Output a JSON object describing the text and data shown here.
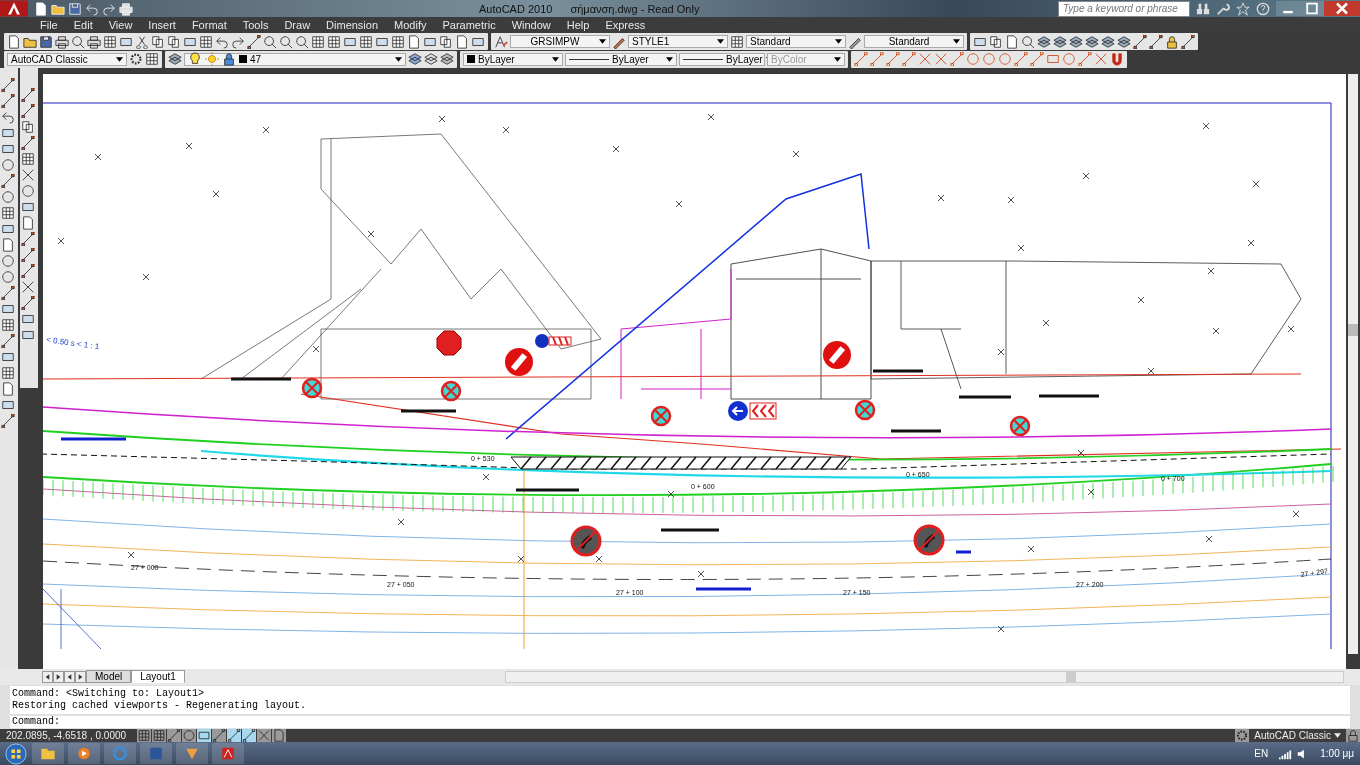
{
  "title_bar": {
    "app_name": "AutoCAD 2010",
    "document": "σήμανση.dwg - Read Only",
    "search": {
      "placeholder": "Type a keyword or phrase"
    }
  },
  "menu": [
    "File",
    "Edit",
    "View",
    "Insert",
    "Format",
    "Tools",
    "Draw",
    "Dimension",
    "Modify",
    "Parametric",
    "Window",
    "Help",
    "Express"
  ],
  "styles_toolbar": {
    "text_style": "GRSIMPW",
    "dimension_style": "STYLE1",
    "table_style": "Standard",
    "multileader_style": "Standard"
  },
  "workspace_toolbar": {
    "workspace": "AutoCAD Classic"
  },
  "layers_toolbar": {
    "layer": "47"
  },
  "properties_toolbar": {
    "color_setting": "ByLayer",
    "linetype": "ByLayer",
    "lineweight": "ByLayer",
    "plot_style": "ByColor",
    "plot_style_disabled": true
  },
  "drawing": {
    "scale_note": "< 0.50  s < 1 : 1",
    "chainages": [
      "27 + 000",
      "27 + 050",
      "27 + 100",
      "27 + 150",
      "27 + 200",
      "27 + 297",
      "0 + 530",
      "0 + 600",
      "0 + 650",
      "0 + 700"
    ],
    "signs": [
      {
        "kind": "stop"
      },
      {
        "kind": "keep-left-chevron"
      },
      {
        "kind": "no-entry"
      },
      {
        "kind": "no-entry"
      },
      {
        "kind": "no-stopping"
      },
      {
        "kind": "no-stopping"
      },
      {
        "kind": "no-stopping"
      },
      {
        "kind": "no-stopping"
      },
      {
        "kind": "no-stopping"
      },
      {
        "kind": "keep-left-chevron-large"
      },
      {
        "kind": "no-overtaking"
      },
      {
        "kind": "no-overtaking"
      }
    ]
  },
  "layout_tabs": [
    {
      "label": "Model",
      "selected": false
    },
    {
      "label": "Layout1",
      "selected": true
    }
  ],
  "command_history": [
    "Command:  <Switching to: Layout1>",
    "Restoring cached viewports - Regenerating layout."
  ],
  "command_prompt": "Command:",
  "status_bar": {
    "coordinates": "202.0895, -4.6518 , 0.0000",
    "toggles": [
      {
        "on": false
      },
      {
        "on": false
      },
      {
        "on": false
      },
      {
        "on": false
      },
      {
        "on": true
      },
      {
        "on": false
      },
      {
        "on": true
      },
      {
        "on": true
      },
      {
        "on": false
      },
      {
        "on": false
      }
    ],
    "workspace": "AutoCAD Classic"
  },
  "taskbar": {
    "language": "EN",
    "clock": "1:00 μμ"
  }
}
